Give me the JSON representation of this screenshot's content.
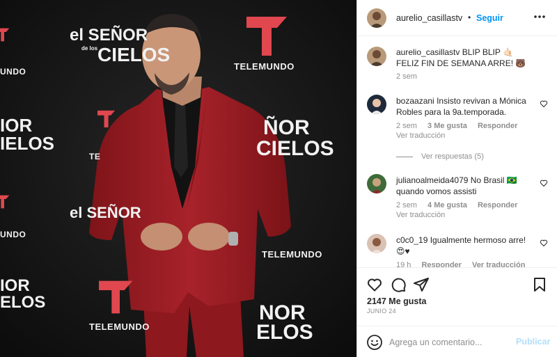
{
  "photo": {
    "wall_brand_top": "el SEÑOR",
    "wall_brand_sub": "de los",
    "wall_brand_bottom": "CIELOS",
    "wall_frag_1": "ÑOR",
    "wall_frag_2": "CIELOS",
    "wall_frag_3": "IOR",
    "wall_frag_4": "IELOS",
    "wall_frag_5": "NOR",
    "wall_frag_6": "ELOS",
    "wall_frag_7": "IOR",
    "wall_frag_8": "ELOS",
    "telemundo_1": "TELEMUNDO",
    "telemundo_2": "TELEMUNDO",
    "telemundo_3": "TELEMUNDO",
    "telemundo_4": "UNDO",
    "telemundo_5": "TE",
    "telemundo_6": "UNDO",
    "colors": {
      "suit": "#9e1c23",
      "backdrop": "#141414",
      "logo": "#e0474f"
    }
  },
  "header": {
    "username": "aurelio_casillastv",
    "separator": "•",
    "follow_label": "Seguir",
    "more_icon": "more-horizontal-icon"
  },
  "caption": {
    "username": "aurelio_casillastv",
    "text": "BLIP BLIP 🤙🏻 FELIZ FIN DE SEMANA ARRE! 🐻",
    "time": "2 sem"
  },
  "comments": [
    {
      "username": "bozaazani",
      "text": "Insisto revivan a Mónica Robles para la 9a.temporada.",
      "time": "2 sem",
      "likes": "3 Me gusta",
      "reply": "Responder",
      "translate": "Ver traducción",
      "view_replies": "Ver respuestas (5)"
    },
    {
      "username": "julianoalmeida4079",
      "text": "No Brasil 🇧🇷 quando vomos assisti",
      "time": "2 sem",
      "likes": "4 Me gusta",
      "reply": "Responder",
      "translate": "Ver traducción"
    },
    {
      "username": "c0c0_19",
      "text": "Igualmente hermoso arre! 😍♥",
      "time": "19 h",
      "reply": "Responder",
      "translate": "Ver traducción"
    }
  ],
  "actions": {
    "icons": [
      "heart-icon",
      "comment-icon",
      "share-icon",
      "bookmark-icon"
    ],
    "likes": "2147 Me gusta",
    "date": "JUNIO 24"
  },
  "add_comment": {
    "placeholder": "Agrega un comentario...",
    "publish_label": "Publicar"
  },
  "colors": {
    "link": "#0095f6",
    "publish_disabled": "#b2dffc",
    "muted": "#8e8e8e",
    "text": "#262626"
  }
}
